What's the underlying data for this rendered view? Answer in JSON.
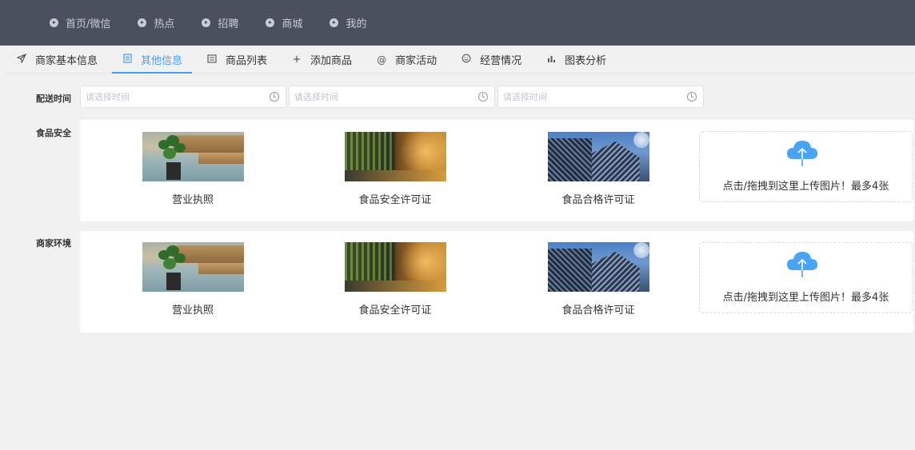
{
  "topnav": {
    "items": [
      "首页/微信",
      "热点",
      "招聘",
      "商城",
      "我的"
    ]
  },
  "tabs": [
    {
      "label": "商家基本信息",
      "icon": "send-icon"
    },
    {
      "label": "其他信息",
      "icon": "document-icon",
      "active": true
    },
    {
      "label": "商品列表",
      "icon": "list-icon"
    },
    {
      "label": "添加商品",
      "icon": "plus-icon"
    },
    {
      "label": "商家活动",
      "icon": "at-icon"
    },
    {
      "label": "经营情况",
      "icon": "smile-icon"
    },
    {
      "label": "图表分析",
      "icon": "bar-chart-icon"
    }
  ],
  "delivery": {
    "label": "配送时间",
    "inputs": [
      {
        "placeholder": "请选择时间"
      },
      {
        "placeholder": "请选择时间"
      },
      {
        "placeholder": "请选择时间"
      }
    ]
  },
  "food_safety": {
    "label": "食品安全",
    "cards": [
      "营业执照",
      "食品安全许可证",
      "食品合格许可证"
    ],
    "upload_text": "点击/拖拽到这里上传图片！最多4张"
  },
  "environment": {
    "label": "商家环境",
    "cards": [
      "营业执照",
      "食品安全许可证",
      "食品合格许可证"
    ],
    "upload_text": "点击/拖拽到这里上传图片！最多4张"
  },
  "colors": {
    "topnav_bg": "#4b505e",
    "accent": "#409eff",
    "upload_icon": "#4aa4f6"
  }
}
